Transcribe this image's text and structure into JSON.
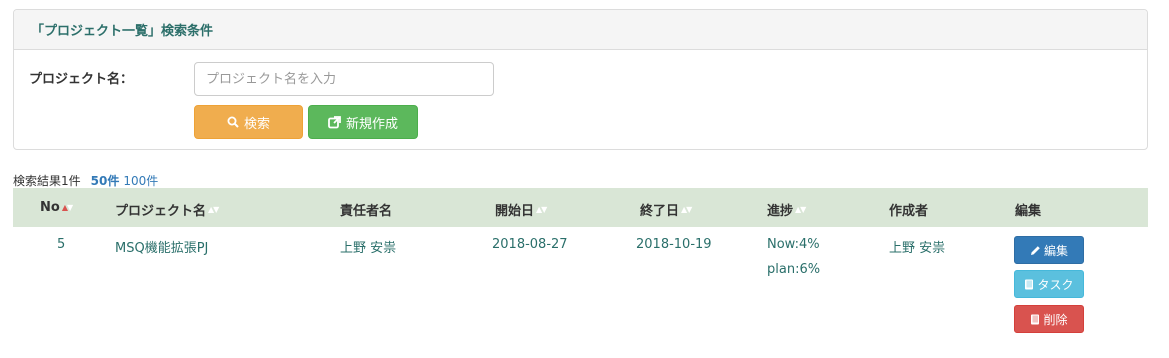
{
  "panel": {
    "title": "「プロジェクト一覧」検索条件",
    "project_label": "プロジェクト名：",
    "search_placeholder": "プロジェクト名を入力",
    "search_value": "",
    "search_button": "検索",
    "new_button": "新規作成"
  },
  "results": {
    "count_text": "検索結果1件",
    "page_size_50": "50件",
    "page_size_100": "100件"
  },
  "table": {
    "headers": {
      "no": "No",
      "project": "プロジェクト名",
      "manager": "責任者名",
      "start": "開始日",
      "end": "終了日",
      "progress": "進捗",
      "creator": "作成者",
      "edit": "編集"
    },
    "rows": [
      {
        "no": "5",
        "project": "MSQ機能拡張PJ",
        "manager": "上野 安祟",
        "start": "2018-08-27",
        "end": "2018-10-19",
        "progress_now": "Now:4%",
        "progress_plan": "plan:6%",
        "creator": "上野 安祟",
        "edit_button": "編集",
        "task_button": "タスク",
        "delete_button": "削除"
      }
    ]
  },
  "colors": {
    "header_bg": "#d9e6d6",
    "link": "#337ab7",
    "text_teal": "#2a6f6a",
    "btn_search": "#f0ad4e",
    "btn_new": "#5cb85c",
    "btn_edit": "#337ab7",
    "btn_task": "#5bc0de",
    "btn_delete": "#d9534f",
    "sort_active": "#d9534f"
  },
  "icons": {
    "search": "search-icon",
    "new": "external-link-icon",
    "edit": "pencil-icon",
    "task": "book-icon",
    "delete": "book-icon"
  }
}
